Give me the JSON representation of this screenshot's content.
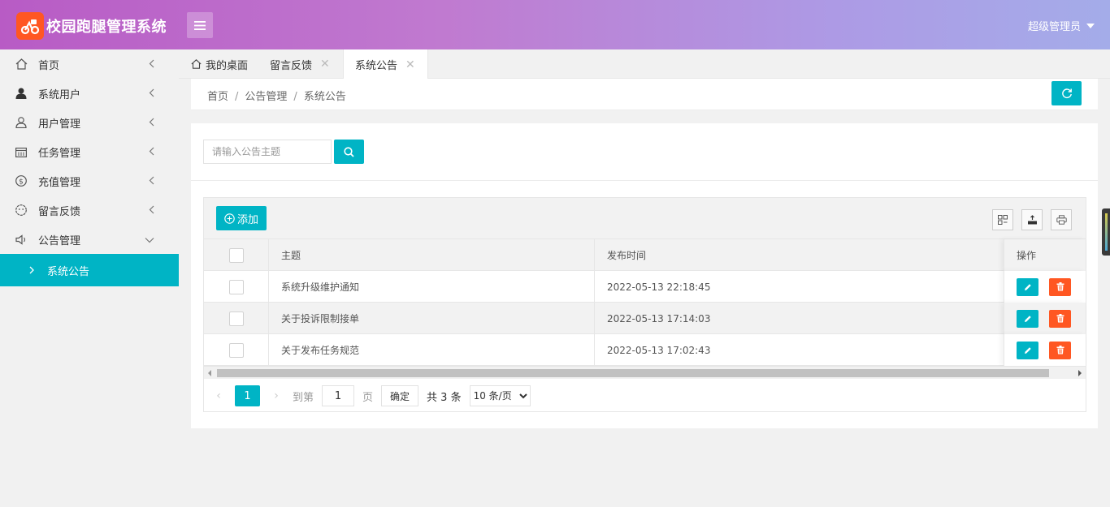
{
  "header": {
    "app_title": "校园跑腿管理系统",
    "user_label": "超级管理员"
  },
  "sidebar": {
    "items": [
      {
        "label": "首页",
        "icon": "home-icon"
      },
      {
        "label": "系统用户",
        "icon": "user-solid-icon"
      },
      {
        "label": "用户管理",
        "icon": "user-icon"
      },
      {
        "label": "任务管理",
        "icon": "calendar-icon"
      },
      {
        "label": "充值管理",
        "icon": "dollar-icon"
      },
      {
        "label": "留言反馈",
        "icon": "face-icon"
      },
      {
        "label": "公告管理",
        "icon": "speaker-icon"
      }
    ],
    "active_sub": "系统公告"
  },
  "tabs": [
    {
      "label": "我的桌面",
      "closable": false
    },
    {
      "label": "留言反馈",
      "closable": true
    },
    {
      "label": "系统公告",
      "closable": true,
      "active": true
    }
  ],
  "breadcrumb": [
    "首页",
    "公告管理",
    "系统公告"
  ],
  "search": {
    "placeholder": "请输入公告主题",
    "value": ""
  },
  "toolbar": {
    "add_label": "添加"
  },
  "table": {
    "columns": [
      "主题",
      "发布时间",
      "操作"
    ],
    "rows": [
      {
        "title": "系统升级维护通知",
        "time": "2022-05-13 22:18:45"
      },
      {
        "title": "关于投诉限制接单",
        "time": "2022-05-13 17:14:03"
      },
      {
        "title": "关于发布任务规范",
        "time": "2022-05-13 17:02:43"
      }
    ]
  },
  "pagination": {
    "current": "1",
    "goto_label": "到第",
    "goto_value": "1",
    "page_label": "页",
    "confirm_label": "确定",
    "total_label": "共 3 条",
    "page_size": "10 条/页"
  },
  "colors": {
    "accent": "#00b4c5",
    "danger": "#ff5722",
    "logo": "#ff5722"
  }
}
